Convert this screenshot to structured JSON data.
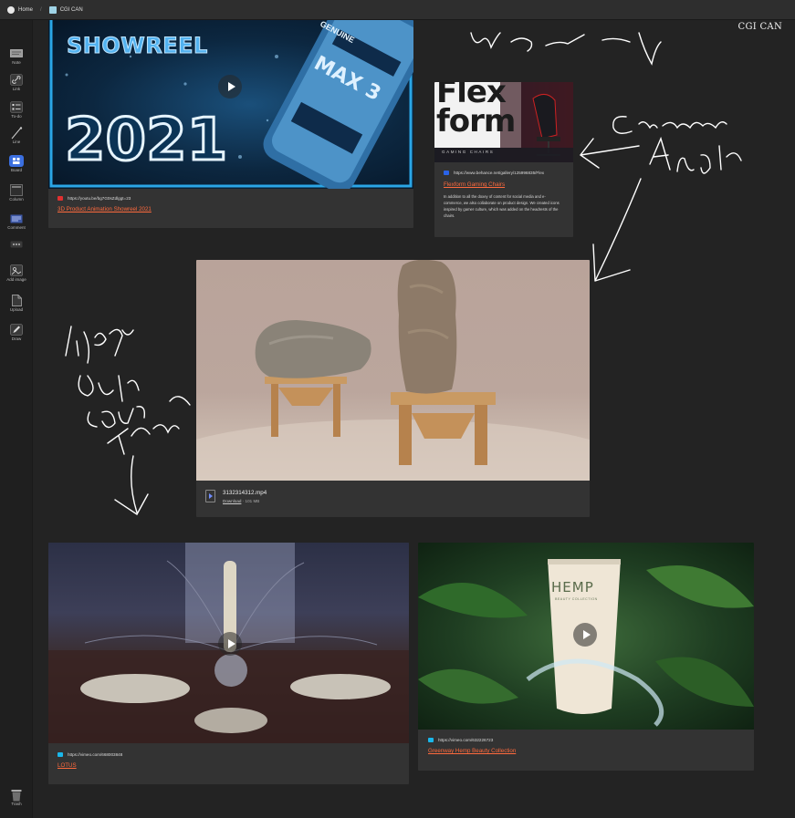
{
  "topbar": {
    "home_label": "Home",
    "separator": "/",
    "board_label": "CGI CAN"
  },
  "board_title": "CGI CAN",
  "sidebar": {
    "tools": [
      {
        "label": "Note",
        "icon": "note-icon"
      },
      {
        "label": "Link",
        "icon": "link-icon"
      },
      {
        "label": "To-do",
        "icon": "todo-icon"
      },
      {
        "label": "Line",
        "icon": "line-icon"
      },
      {
        "label": "Board",
        "icon": "board-icon"
      },
      {
        "label": "Column",
        "icon": "column-icon"
      },
      {
        "label": "Comment",
        "icon": "comment-icon"
      },
      {
        "label": "",
        "icon": "more-icon"
      },
      {
        "label": "Add image",
        "icon": "add-image-icon"
      },
      {
        "label": "Upload",
        "icon": "upload-icon"
      },
      {
        "label": "Draw",
        "icon": "draw-icon"
      }
    ],
    "trash_label": "Trash"
  },
  "cards": {
    "showreel": {
      "image_text_top": "SHOWREEL",
      "image_text_year": "2021",
      "can_text": "MAX 3",
      "can_brand": "GENUINE",
      "url": "https://youtu.be/bg7G0sZdlggt=23",
      "title": "3D Product Animation Showreel 2021"
    },
    "flexform": {
      "image_text_1": "Flex",
      "image_text_2": "form",
      "image_sub": "GAMING CHAIRS",
      "url": "https://www.behance.net/gallery/125996835/Flex",
      "title": "Flexform Gaming Chairs",
      "description": "In addition to all the doxey of content for social media and e-commerce, we also collaborate on product design. We created icons inspired by gamer culture, which was added on the headrests of the chairs."
    },
    "video_file": {
      "filename": "3132314312.mp4",
      "download_label": "Download",
      "size": "101 MB"
    },
    "lotus": {
      "url": "https://vimeo.com/668003848",
      "title": "LOTUS"
    },
    "hemp": {
      "brand": "HEMP",
      "sub": "BEAUTY COLLECTION",
      "url": "https://vimeo.com/632226723",
      "title": "Greenway Hemp Beauty Collection"
    }
  },
  "annotations": {
    "top_scribble": "What's the way",
    "camera_angle_1": "Camera",
    "camera_angle_2": "Angle",
    "left_note_1": "Like the",
    "left_note_2": "outer",
    "left_note_3": "focus",
    "left_note_4": "transition"
  },
  "colors": {
    "accent_link": "#ff6a3d",
    "board_active": "#3b6fe0",
    "background": "#232323",
    "card": "#333333"
  }
}
